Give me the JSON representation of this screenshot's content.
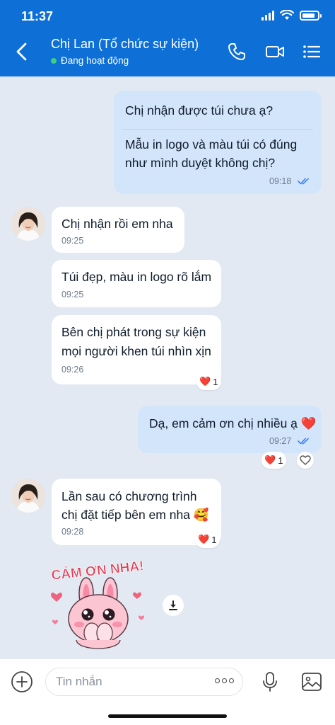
{
  "status_bar": {
    "time": "11:37",
    "battery_level": 0.85
  },
  "header": {
    "contact_name": "Chị Lan (Tổ chức sự kiện)",
    "status": "Đang hoạt động",
    "status_color": "#3dd07a",
    "bar_color": "#0e6fd6",
    "icons": [
      "back-icon",
      "phone-icon",
      "video-icon",
      "menu-icon"
    ]
  },
  "messages": {
    "m1": {
      "line1": "Chị nhận được túi chưa ạ?",
      "line2": "Mẫu in logo và màu túi có đúng",
      "line3": "như mình duyệt không chị?",
      "time": "09:18"
    },
    "m2": {
      "text": "Chị nhận rồi em nha",
      "time": "09:25"
    },
    "m3": {
      "text": "Túi đẹp, màu in logo rõ lắm",
      "time": "09:25"
    },
    "m4": {
      "line1": "Bên chị phát trong sự kiện",
      "line2": "mọi người khen túi nhìn xịn",
      "time": "09:26",
      "reaction": "❤️",
      "reaction_count": "1"
    },
    "m5": {
      "text": "Dạ, em cảm ơn chị nhiều ạ ❤️",
      "time": "09:27",
      "reaction": "❤️",
      "reaction_count": "1"
    },
    "m6": {
      "line1": "Lần sau có chương trình",
      "line2": "chị đặt tiếp bên em nha 🥰",
      "time": "09:28",
      "reaction": "❤️",
      "reaction_count": "1"
    },
    "sticker": {
      "text": "CẢM ƠN NHA!"
    }
  },
  "input": {
    "placeholder": "Tin nhắn"
  },
  "colors": {
    "outgoing_bubble": "#d3e5fb",
    "incoming_bubble": "#ffffff",
    "background": "#e2e9f3",
    "read_check": "#3b82f6"
  }
}
